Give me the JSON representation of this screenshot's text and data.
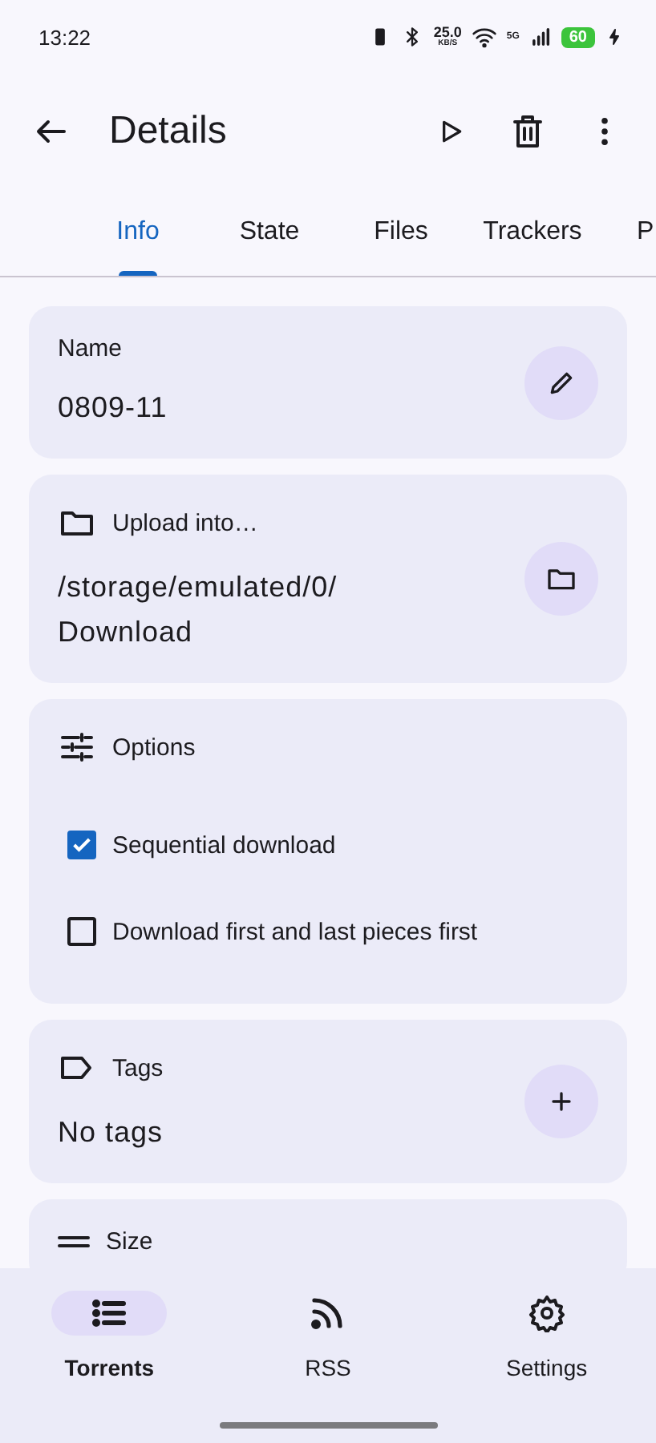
{
  "status_bar": {
    "time": "13:22",
    "net_speed": "25.0",
    "net_unit": "KB/S",
    "network": "5G",
    "battery": "60"
  },
  "app_bar": {
    "title": "Details"
  },
  "tabs": [
    {
      "label": "Info",
      "selected": true
    },
    {
      "label": "State",
      "selected": false
    },
    {
      "label": "Files",
      "selected": false
    },
    {
      "label": "Trackers",
      "selected": false
    },
    {
      "label": "P",
      "selected": false
    }
  ],
  "cards": [
    {
      "kind": "name",
      "title": "Name",
      "value": "0809-11"
    },
    {
      "kind": "folder",
      "title": "Upload into…",
      "value": "/storage/emulated/0/\nDownload"
    },
    {
      "kind": "options",
      "title": "Options",
      "options": [
        {
          "label": "Sequential download",
          "checked": true
        },
        {
          "label": "Download first and last pieces first",
          "checked": false
        }
      ]
    },
    {
      "kind": "tags",
      "title": "Tags",
      "value": "No tags"
    },
    {
      "kind": "size",
      "title": "Size"
    }
  ],
  "bottom_nav": [
    {
      "label": "Torrents",
      "selected": true
    },
    {
      "label": "RSS",
      "selected": false
    },
    {
      "label": "Settings",
      "selected": false
    }
  ]
}
